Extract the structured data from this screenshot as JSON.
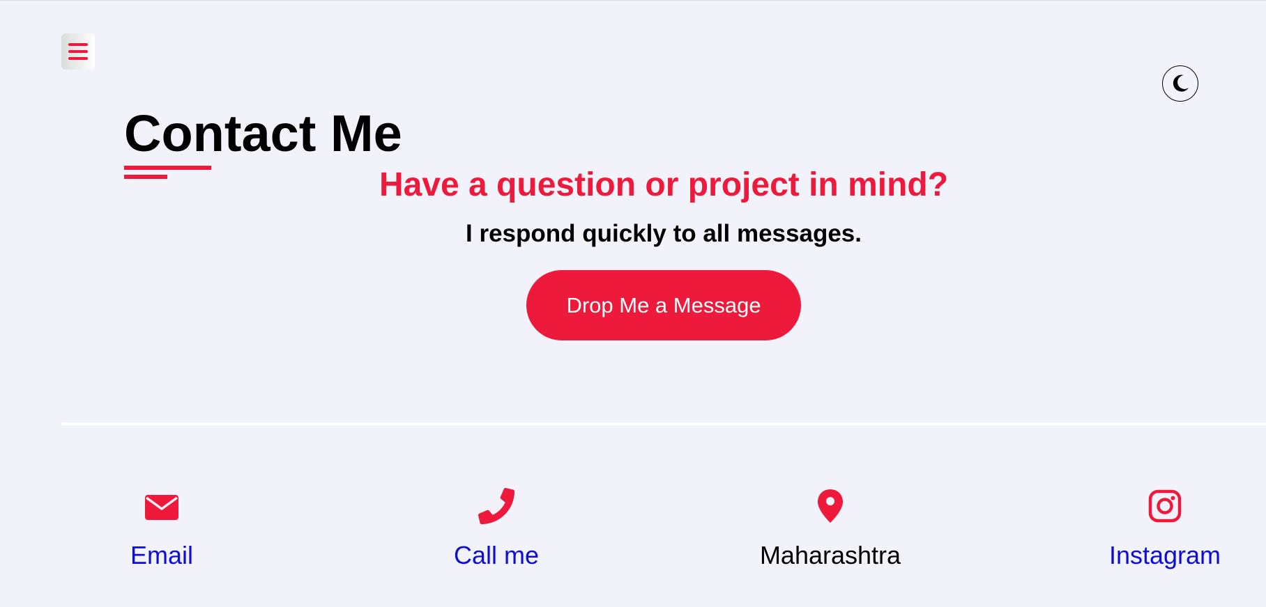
{
  "header": {
    "menu_icon": "hamburger-icon",
    "theme_toggle_icon": "moon-icon"
  },
  "contact": {
    "title": "Contact Me",
    "question": "Have a question or project in mind?",
    "subtitle": "I respond quickly to all messages.",
    "cta_label": "Drop Me a Message"
  },
  "contact_items": [
    {
      "icon": "envelope-icon",
      "label": "Email",
      "link": true
    },
    {
      "icon": "phone-icon",
      "label": "Call me",
      "link": true
    },
    {
      "icon": "map-pin-icon",
      "label": "Maharashtra",
      "link": false
    },
    {
      "icon": "instagram-icon",
      "label": "Instagram",
      "link": true
    }
  ],
  "colors": {
    "accent": "#ed1a3b",
    "background": "#f2f2fb",
    "link": "#0d0dd5",
    "text": "#000000"
  }
}
